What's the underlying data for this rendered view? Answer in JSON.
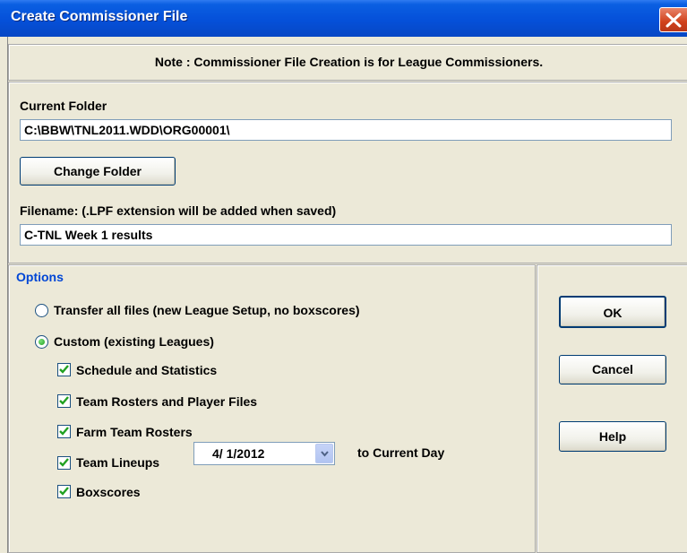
{
  "window": {
    "title": "Create Commissioner File",
    "close_icon": "close-icon"
  },
  "note": "Note : Commissioner File Creation is for League Commissioners.",
  "folder": {
    "current_label": "Current Folder",
    "current_value": "C:\\BBW\\TNL2011.WDD\\ORG00001\\",
    "change_button": "Change Folder"
  },
  "filename": {
    "label": "Filename: (.LPF extension will be added when saved)",
    "value": "C-TNL Week 1 results"
  },
  "options": {
    "legend": "Options",
    "radio_transfer": {
      "label": "Transfer all files (new League Setup, no boxscores)",
      "selected": false
    },
    "radio_custom": {
      "label": "Custom (existing Leagues)",
      "selected": true
    },
    "checkboxes": [
      {
        "label": "Schedule and Statistics",
        "checked": true
      },
      {
        "label": "Team Rosters and Player Files",
        "checked": true
      },
      {
        "label": "Farm Team Rosters",
        "checked": true
      },
      {
        "label": "Team Lineups",
        "checked": true
      },
      {
        "label": "Boxscores",
        "checked": true
      }
    ],
    "boxscore_date": "4/ 1/2012",
    "to_current_day": "to Current Day"
  },
  "buttons": {
    "ok": "OK",
    "cancel": "Cancel",
    "help": "Help"
  },
  "colors": {
    "titlebar": "#0550d9",
    "dialog_bg": "#ece9d8",
    "options_legend": "#0046d5",
    "check_mark": "#21a121"
  }
}
